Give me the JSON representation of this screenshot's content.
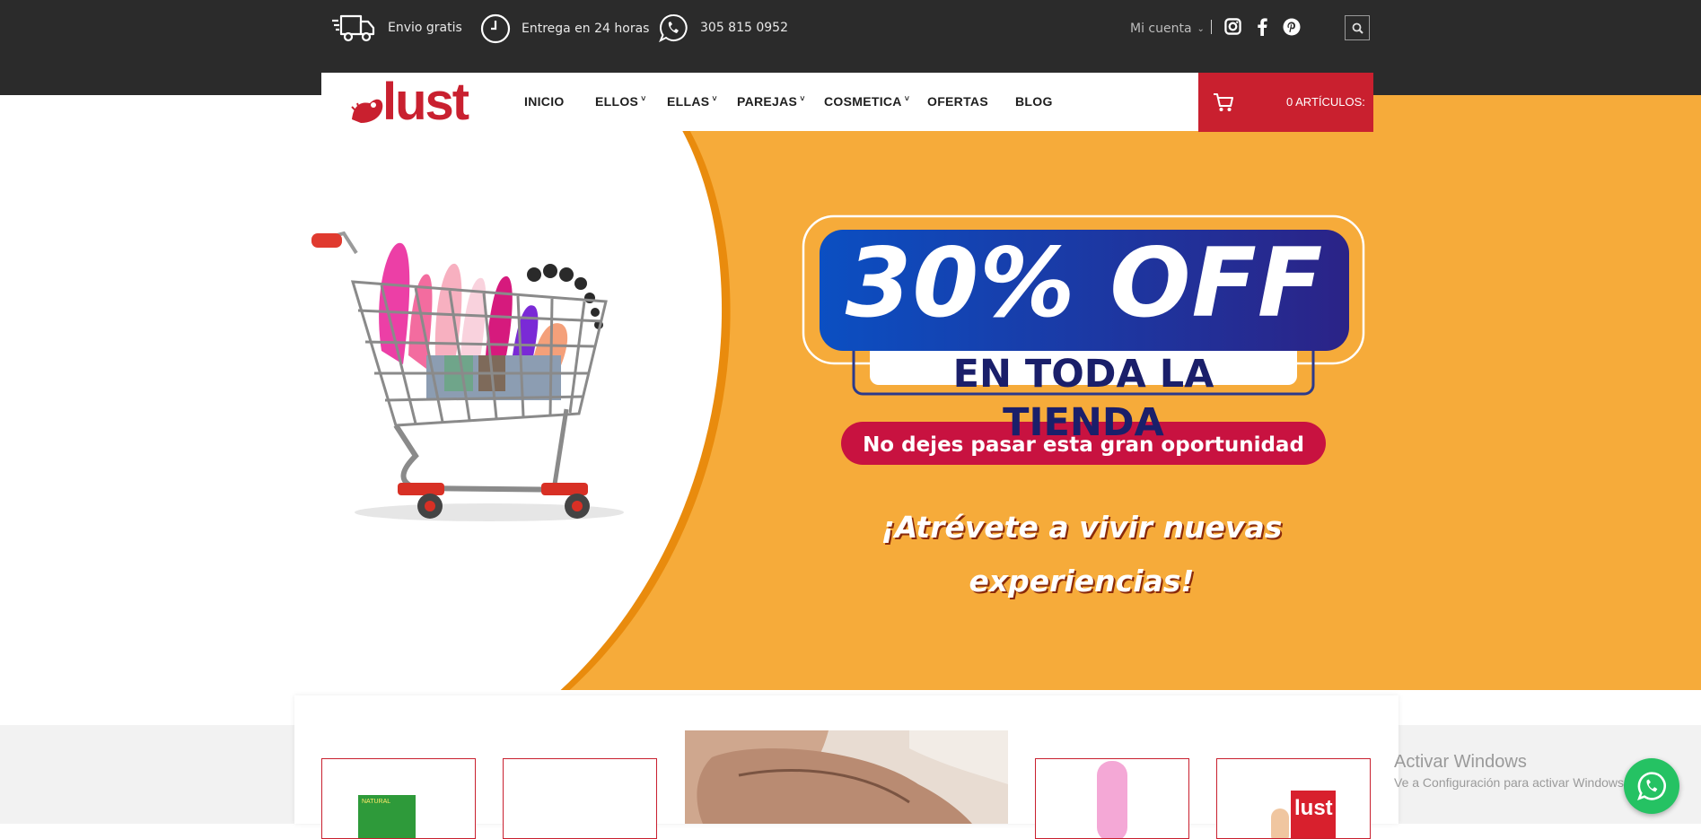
{
  "topbar": {
    "shipping": "Envio gratis",
    "delivery": "Entrega en 24 horas",
    "phone": "305 815 0952",
    "account": "Mi cuenta",
    "icons": [
      "truck-icon",
      "clock-icon",
      "whatsapp-icon",
      "instagram-icon",
      "facebook-icon",
      "pinterest-icon",
      "search-icon"
    ]
  },
  "logo": {
    "text": "lust",
    "color": "#c9202f"
  },
  "nav": {
    "items": [
      {
        "label": "INICIO",
        "dropdown": false
      },
      {
        "label": "ELLOS",
        "dropdown": true
      },
      {
        "label": "ELLAS",
        "dropdown": true
      },
      {
        "label": "PAREJAS",
        "dropdown": true
      },
      {
        "label": "COSMETICA",
        "dropdown": true
      },
      {
        "label": "OFERTAS",
        "dropdown": false
      },
      {
        "label": "BLOG",
        "dropdown": false
      }
    ]
  },
  "cart": {
    "label": "0 ARTÍCULOS:",
    "color": "#c9202f"
  },
  "hero": {
    "headline": "30% OFF",
    "subheadline": "EN TODA LA TIENDA",
    "cta": "No dejes pasar esta gran oportunidad",
    "tagline": "¡Atrévete a vivir nuevas experiencias!",
    "bg_color": "#f6ab3a",
    "accent_blue": "#1a2a8a"
  },
  "watermark": {
    "title": "Activar Windows",
    "subtitle": "Ve a Configuración para activar Windows."
  },
  "products": {
    "brand_box": "lust",
    "pack_label": "NATURAL"
  }
}
